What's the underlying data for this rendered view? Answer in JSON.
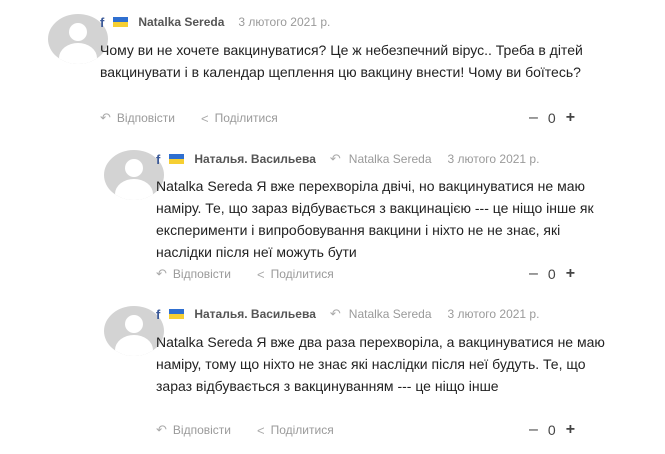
{
  "comments": [
    {
      "author": "Natalka Sereda",
      "reply_to": "",
      "date": "3 лютого 2021 р.",
      "text": "Чому ви не хочете вакцинуватися? Це ж небезпечний вірус.. Треба в дітей вакцинувати і в календар щеплення цю вакцину внести! Чому ви боїтесь?",
      "reply_label": "Відповісти",
      "share_label": "Поділитися",
      "score": "0"
    },
    {
      "author": "Наталья. Васильева",
      "reply_to": "Natalka Sereda",
      "date": "3 лютого 2021 р.",
      "text": "Natalka Sereda Я вже перехворіла  двічі, но вакцинуватися не маю наміру.  Те, що зараз відбувається з вакцинацією --- це ніщо інше як експерименти  і випробовування вакцини і ніхто не не знає,  які наслідки  після неї можуть бути",
      "reply_label": "Відповісти",
      "share_label": "Поділитися",
      "score": "0"
    },
    {
      "author": "Наталья. Васильева",
      "reply_to": "Natalka Sereda",
      "date": "3 лютого 2021 р.",
      "text": "Natalka Sereda Я вже два раза перехворіла, а вакцинуватися не   маю наміру, тому що ніхто не знає  які наслідки  після  неї будуть. Те, що зараз відбувається з вакцинуванням  --- це ніщо інше",
      "reply_label": "Відповісти",
      "share_label": "Поділитися",
      "score": "0"
    }
  ],
  "icons": {
    "network": "facebook-icon",
    "flag": "ukraine-flag-icon",
    "reply": "reply-arrow-icon",
    "share": "share-icon"
  },
  "colors": {
    "facebook": "#3b5998",
    "flag_blue": "#2f6fd0",
    "flag_yellow": "#f6cf32",
    "muted": "#9a9a9a",
    "avatar": "#d3d3d3"
  }
}
